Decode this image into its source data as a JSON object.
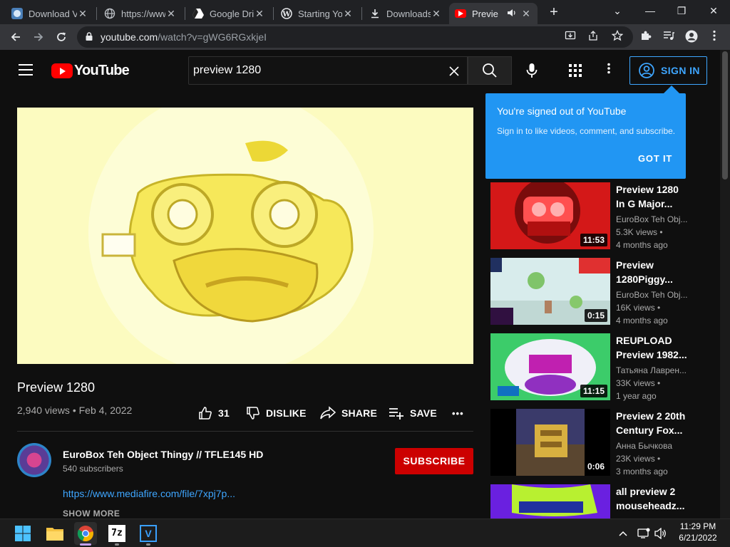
{
  "browser": {
    "tabs": [
      {
        "title": "Download V",
        "icon": "app-icon",
        "active": false
      },
      {
        "title": "https://www",
        "icon": "globe-icon",
        "active": false
      },
      {
        "title": "Google Dri",
        "icon": "drive-icon",
        "active": false
      },
      {
        "title": "Starting Yo",
        "icon": "wordpress-icon",
        "active": false
      },
      {
        "title": "Downloads",
        "icon": "download-icon",
        "active": false
      },
      {
        "title": "Previe",
        "icon": "youtube-icon",
        "active": true
      }
    ],
    "new_tab_label": "+",
    "window_controls": [
      "⌄",
      "—",
      "❐",
      "✕"
    ],
    "url_host": "youtube.com",
    "url_path": "/watch?v=gWG6RGxkjeI"
  },
  "youtube": {
    "logo_text": "YouTube",
    "search_query": "preview 1280",
    "sign_in_label": "SIGN IN"
  },
  "video": {
    "title": "Preview 1280",
    "meta": "2,940 views • Feb 4, 2022",
    "likes": "31",
    "dislike_label": "DISLIKE",
    "share_label": "SHARE",
    "save_label": "SAVE",
    "more_label": "•••"
  },
  "channel": {
    "name": "EuroBox Teh Object Thingy // TFLE145 HD",
    "subscribers": "540 subscribers",
    "subscribe_label": "SUBSCRIBE",
    "description_link": "https://www.mediafire.com/file/7xpj7p...",
    "show_more": "SHOW MORE"
  },
  "tooltip": {
    "heading": "You're signed out of YouTube",
    "body": "Sign in to like videos, comment, and subscribe.",
    "button": "GOT IT"
  },
  "recommendations": [
    {
      "title": "Preview 1280 In G Major...",
      "channel": "EuroBox Teh Obj...",
      "views": "5.3K views •",
      "age": "4 months ago",
      "duration": "11:53"
    },
    {
      "title": "Preview 1280Piggy...",
      "channel": "EuroBox Teh Obj...",
      "views": "16K views •",
      "age": "4 months ago",
      "duration": "0:15"
    },
    {
      "title": "REUPLOAD Preview 1982...",
      "channel": "Татьяна Лаврен...",
      "views": "33K views •",
      "age": "1 year ago",
      "duration": "11:15"
    },
    {
      "title": "Preview 2 20th Century Fox...",
      "channel": "Анна Бычкова",
      "views": "23K views •",
      "age": "3 months ago",
      "duration": "0:06"
    },
    {
      "title": "all preview 2 mouseheadz...",
      "channel": "",
      "views": "",
      "age": "",
      "duration": ""
    }
  ],
  "taskbar": {
    "apps": [
      "start-icon",
      "file-explorer-icon",
      "chrome-icon",
      "7zip-icon",
      "vscode-icon"
    ],
    "sevenzip_label": "7z",
    "vs_label": "V",
    "time": "11:29 PM",
    "date": "6/21/2022"
  },
  "colors": {
    "accent": "#3ea6ff",
    "subscribe": "#cc0000",
    "tooltip": "#2196f3",
    "youtube_red": "#ff0000"
  }
}
